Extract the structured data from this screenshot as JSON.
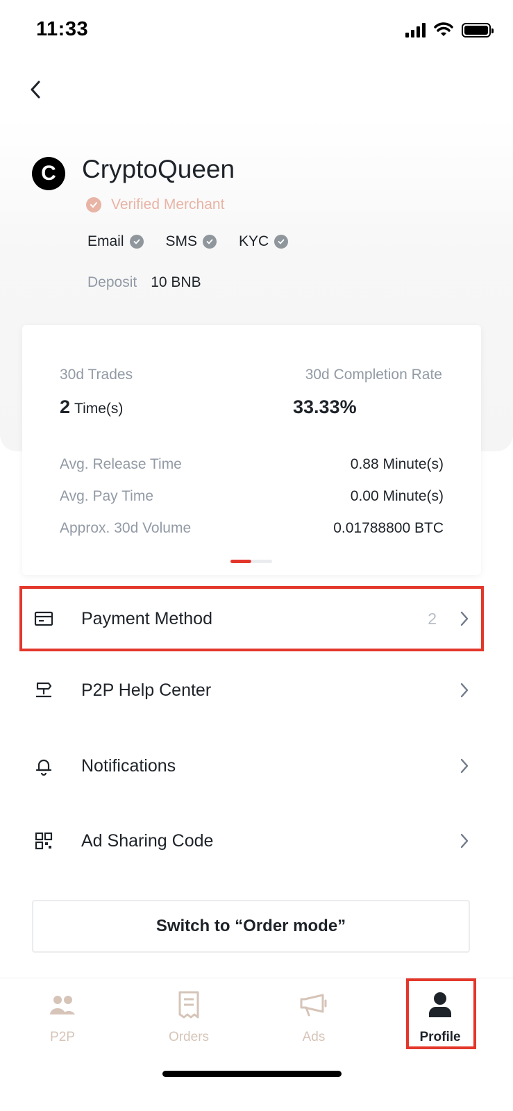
{
  "status_bar": {
    "time": "11:33"
  },
  "profile": {
    "avatar_letter": "C",
    "name": "CryptoQueen",
    "verified_label": "Verified Merchant",
    "verifications": [
      {
        "label": "Email"
      },
      {
        "label": "SMS"
      },
      {
        "label": "KYC"
      }
    ],
    "deposit_label": "Deposit",
    "deposit_value": "10 BNB"
  },
  "stats": {
    "trades_label": "30d Trades",
    "trades_value": "2",
    "trades_unit": "Time(s)",
    "completion_label": "30d Completion Rate",
    "completion_value": "33.33%",
    "metrics": [
      {
        "label": "Avg. Release Time",
        "value": "0.88 Minute(s)"
      },
      {
        "label": "Avg. Pay Time",
        "value": "0.00 Minute(s)"
      },
      {
        "label": "Approx. 30d Volume",
        "value": "0.01788800 BTC"
      }
    ]
  },
  "menu": {
    "payment_method": {
      "label": "Payment Method",
      "count": "2",
      "icon": "card-icon"
    },
    "help_center": {
      "label": "P2P Help Center",
      "icon": "signpost-icon"
    },
    "notifications": {
      "label": "Notifications",
      "icon": "bell-icon"
    },
    "ad_sharing": {
      "label": "Ad Sharing Code",
      "icon": "qr-code-icon"
    }
  },
  "switch_button": {
    "label": "Switch to “Order mode”"
  },
  "tabs": [
    {
      "label": "P2P",
      "icon": "users-icon",
      "active": false
    },
    {
      "label": "Orders",
      "icon": "receipt-icon",
      "active": false
    },
    {
      "label": "Ads",
      "icon": "megaphone-icon",
      "active": false
    },
    {
      "label": "Profile",
      "icon": "person-icon",
      "active": true
    }
  ],
  "colors": {
    "highlight": "#e3372b",
    "verified": "#e8b4a6",
    "muted_text": "#929aa5",
    "inactive_tab": "#d6c4b8",
    "primary_text": "#1e2329"
  }
}
